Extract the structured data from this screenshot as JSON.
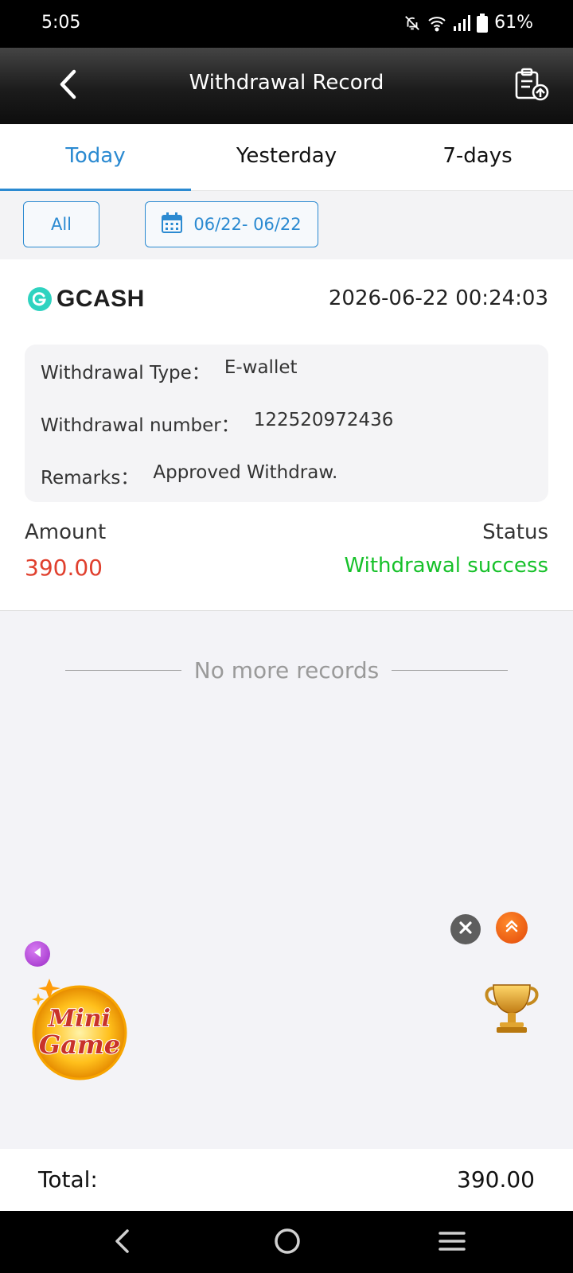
{
  "status_bar": {
    "time": "5:05",
    "battery": "61%",
    "icons": [
      "bell-off-icon",
      "wifi-icon",
      "signal-icon",
      "battery-icon"
    ]
  },
  "header": {
    "title": "Withdrawal Record",
    "back_icon": "chevron-left-icon",
    "action_icon": "clipboard-upload-icon"
  },
  "tabs": [
    {
      "label": "Today",
      "active": true
    },
    {
      "label": "Yesterday",
      "active": false
    },
    {
      "label": "7-days",
      "active": false
    }
  ],
  "filters": {
    "all_label": "All",
    "date_range": "06/22- 06/22",
    "date_icon": "calendar-icon"
  },
  "record": {
    "method": "GCASH",
    "timestamp": "2026-06-22 00:24:03",
    "details": [
      {
        "label": "Withdrawal Type：",
        "value": "E-wallet"
      },
      {
        "label": "Withdrawal number：",
        "value": "122520972436"
      },
      {
        "label": "Remarks：",
        "value": "Approved Withdraw."
      }
    ],
    "amount_label": "Amount",
    "amount_value": "390.00",
    "status_label": "Status",
    "status_value": "Withdrawal success"
  },
  "list_end_text": "No more records",
  "widgets": {
    "minigame_line1": "Mini",
    "minigame_line2": "Game"
  },
  "total": {
    "label": "Total:",
    "value": "390.00"
  },
  "colors": {
    "accent": "#2b8ad1",
    "amount": "#e0402e",
    "success": "#17c12a",
    "gcash": "#2fd3c0"
  }
}
